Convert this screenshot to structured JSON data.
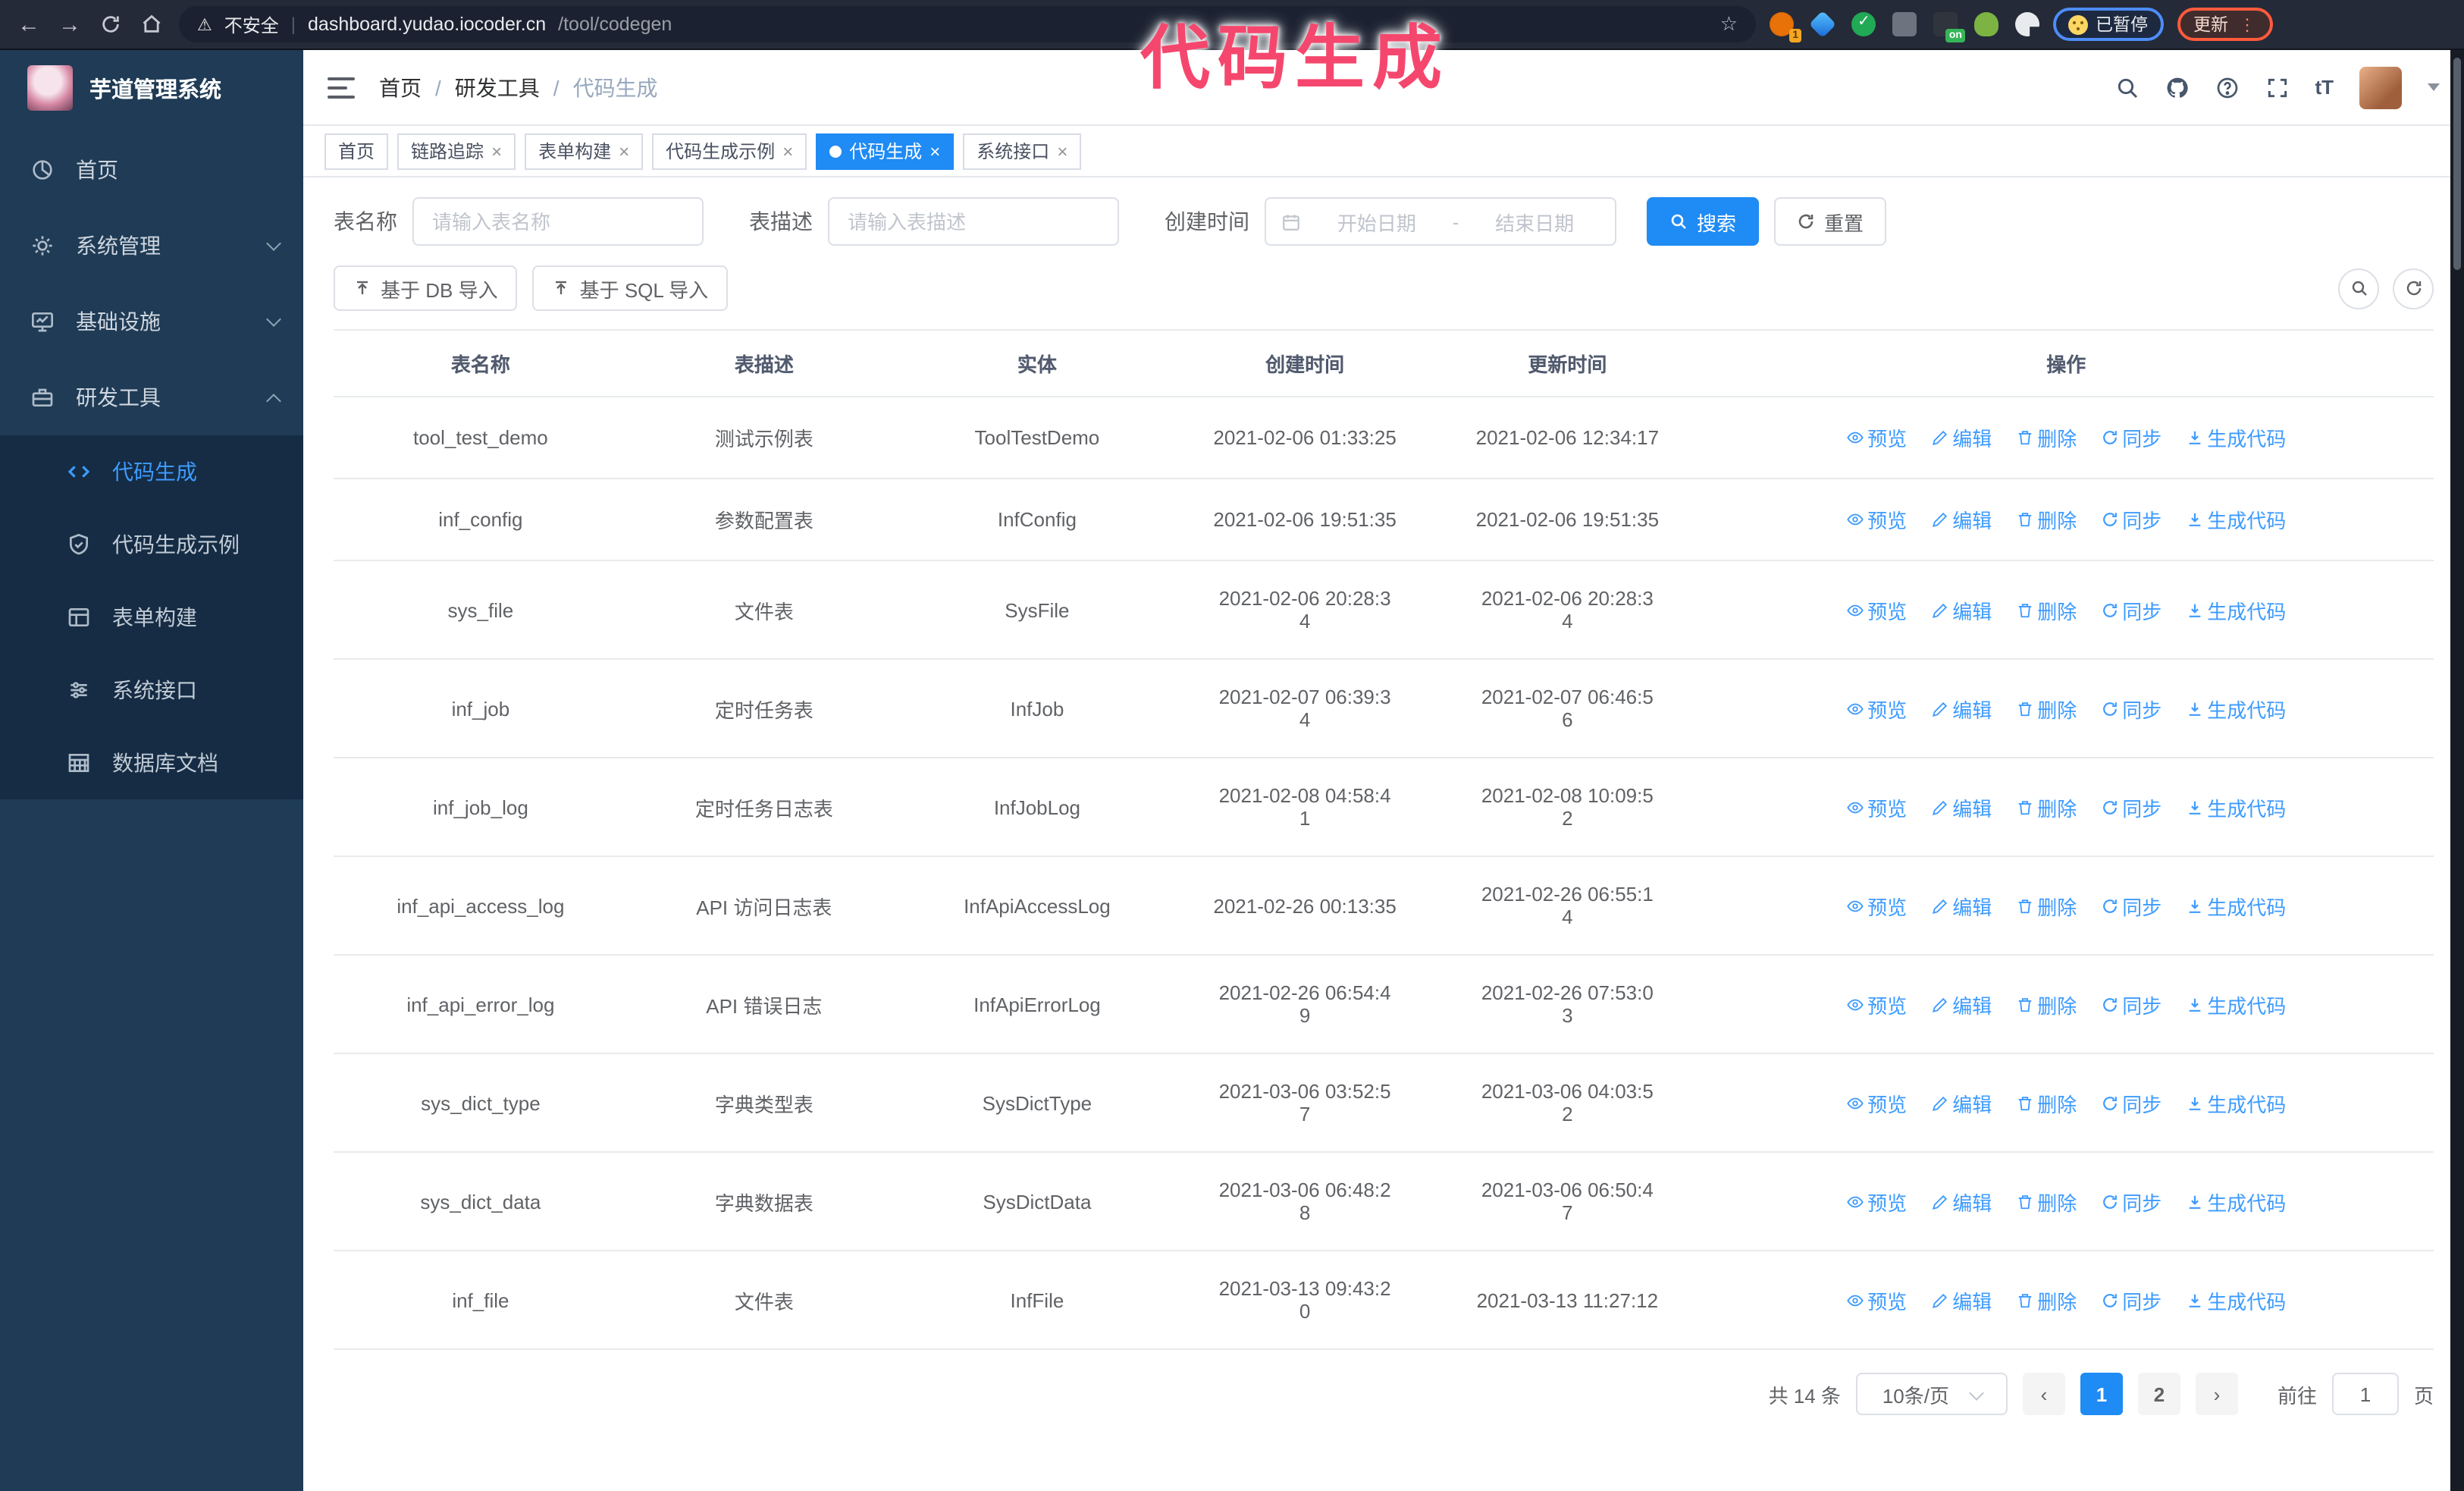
{
  "annotation": "代码生成",
  "browser": {
    "security_label": "不安全",
    "url_host": "dashboard.yudao.iocoder.cn",
    "url_path": "/tool/codegen",
    "paused_label": "已暂停",
    "update_label": "更新",
    "extension_badge_count": "1",
    "extension_badge_on": "on"
  },
  "sidebar": {
    "title": "芋道管理系统",
    "menu": [
      {
        "label": "首页",
        "icon": "dashboard-icon",
        "chevron": null,
        "active": false
      },
      {
        "label": "系统管理",
        "icon": "gear-icon",
        "chevron": "down",
        "active": false
      },
      {
        "label": "基础设施",
        "icon": "monitor-icon",
        "chevron": "down",
        "active": false
      },
      {
        "label": "研发工具",
        "icon": "toolbox-icon",
        "chevron": "up",
        "active": true
      }
    ],
    "submenu": [
      {
        "label": "代码生成",
        "icon": "code-icon",
        "active": true
      },
      {
        "label": "代码生成示例",
        "icon": "shield-check-icon",
        "active": false
      },
      {
        "label": "表单构建",
        "icon": "form-icon",
        "active": false
      },
      {
        "label": "系统接口",
        "icon": "sliders-icon",
        "active": false
      },
      {
        "label": "数据库文档",
        "icon": "database-doc-icon",
        "active": false
      }
    ]
  },
  "header": {
    "breadcrumb": [
      "首页",
      "研发工具",
      "代码生成"
    ]
  },
  "tags": [
    {
      "label": "首页",
      "closable": false,
      "active": false
    },
    {
      "label": "链路追踪",
      "closable": true,
      "active": false
    },
    {
      "label": "表单构建",
      "closable": true,
      "active": false
    },
    {
      "label": "代码生成示例",
      "closable": true,
      "active": false
    },
    {
      "label": "代码生成",
      "closable": true,
      "active": true
    },
    {
      "label": "系统接口",
      "closable": true,
      "active": false
    }
  ],
  "search": {
    "name_label": "表名称",
    "name_placeholder": "请输入表名称",
    "desc_label": "表描述",
    "desc_placeholder": "请输入表描述",
    "time_label": "创建时间",
    "start_placeholder": "开始日期",
    "range_separator": "-",
    "end_placeholder": "结束日期",
    "search_button": "搜索",
    "reset_button": "重置"
  },
  "toolbar": {
    "import_db_button": "基于 DB 导入",
    "import_sql_button": "基于 SQL 导入"
  },
  "table": {
    "headers": [
      "表名称",
      "表描述",
      "实体",
      "创建时间",
      "更新时间",
      "操作"
    ],
    "actions": [
      {
        "label": "预览",
        "icon": "eye-icon"
      },
      {
        "label": "编辑",
        "icon": "edit-icon"
      },
      {
        "label": "删除",
        "icon": "delete-icon"
      },
      {
        "label": "同步",
        "icon": "sync-icon"
      },
      {
        "label": "生成代码",
        "icon": "download-icon"
      }
    ],
    "rows": [
      {
        "name": "tool_test_demo",
        "desc": "测试示例表",
        "entity": "ToolTestDemo",
        "created": "2021-02-06 01:33:25",
        "updated": "2021-02-06 12:34:17"
      },
      {
        "name": "inf_config",
        "desc": "参数配置表",
        "entity": "InfConfig",
        "created": "2021-02-06 19:51:35",
        "updated": "2021-02-06 19:51:35"
      },
      {
        "name": "sys_file",
        "desc": "文件表",
        "entity": "SysFile",
        "created": "2021-02-06 20:28:3\n4",
        "updated": "2021-02-06 20:28:3\n4"
      },
      {
        "name": "inf_job",
        "desc": "定时任务表",
        "entity": "InfJob",
        "created": "2021-02-07 06:39:3\n4",
        "updated": "2021-02-07 06:46:5\n6"
      },
      {
        "name": "inf_job_log",
        "desc": "定时任务日志表",
        "entity": "InfJobLog",
        "created": "2021-02-08 04:58:4\n1",
        "updated": "2021-02-08 10:09:5\n2"
      },
      {
        "name": "inf_api_access_log",
        "desc": "API 访问日志表",
        "entity": "InfApiAccessLog",
        "created": "2021-02-26 00:13:35",
        "updated": "2021-02-26 06:55:1\n4"
      },
      {
        "name": "inf_api_error_log",
        "desc": "API 错误日志",
        "entity": "InfApiErrorLog",
        "created": "2021-02-26 06:54:4\n9",
        "updated": "2021-02-26 07:53:0\n3"
      },
      {
        "name": "sys_dict_type",
        "desc": "字典类型表",
        "entity": "SysDictType",
        "created": "2021-03-06 03:52:5\n7",
        "updated": "2021-03-06 04:03:5\n2"
      },
      {
        "name": "sys_dict_data",
        "desc": "字典数据表",
        "entity": "SysDictData",
        "created": "2021-03-06 06:48:2\n8",
        "updated": "2021-03-06 06:50:4\n7"
      },
      {
        "name": "inf_file",
        "desc": "文件表",
        "entity": "InfFile",
        "created": "2021-03-13 09:43:2\n0",
        "updated": "2021-03-13 11:27:12"
      }
    ]
  },
  "pagination": {
    "total": "共 14 条",
    "page_size": "10条/页",
    "pages": [
      "1",
      "2"
    ],
    "active_page": "1",
    "goto_label": "前往",
    "goto_value": "1",
    "goto_suffix": "页"
  },
  "colors": {
    "accent": "#1f8bf4",
    "sidebar_bg": "#1f3b55",
    "submenu_bg": "#152c44",
    "annotation": "#f5476d"
  }
}
